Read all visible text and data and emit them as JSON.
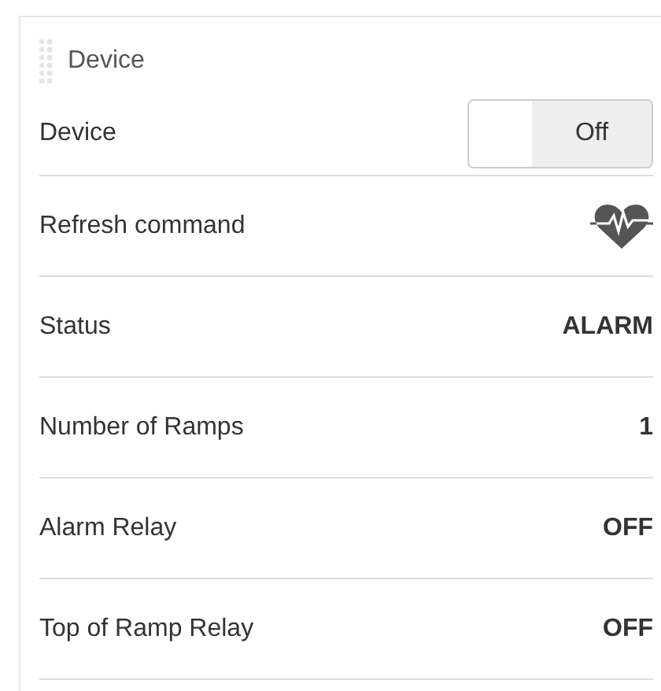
{
  "panel": {
    "title": "Device"
  },
  "rows": [
    {
      "kind": "toggle",
      "label": "Device",
      "value": "Off",
      "on": false
    },
    {
      "kind": "icon",
      "label": "Refresh command"
    },
    {
      "kind": "text",
      "label": "Status",
      "value": "ALARM"
    },
    {
      "kind": "text",
      "label": "Number of Ramps",
      "value": "1"
    },
    {
      "kind": "text",
      "label": "Alarm Relay",
      "value": "OFF"
    },
    {
      "kind": "text",
      "label": "Top of Ramp Relay",
      "value": "OFF"
    }
  ]
}
